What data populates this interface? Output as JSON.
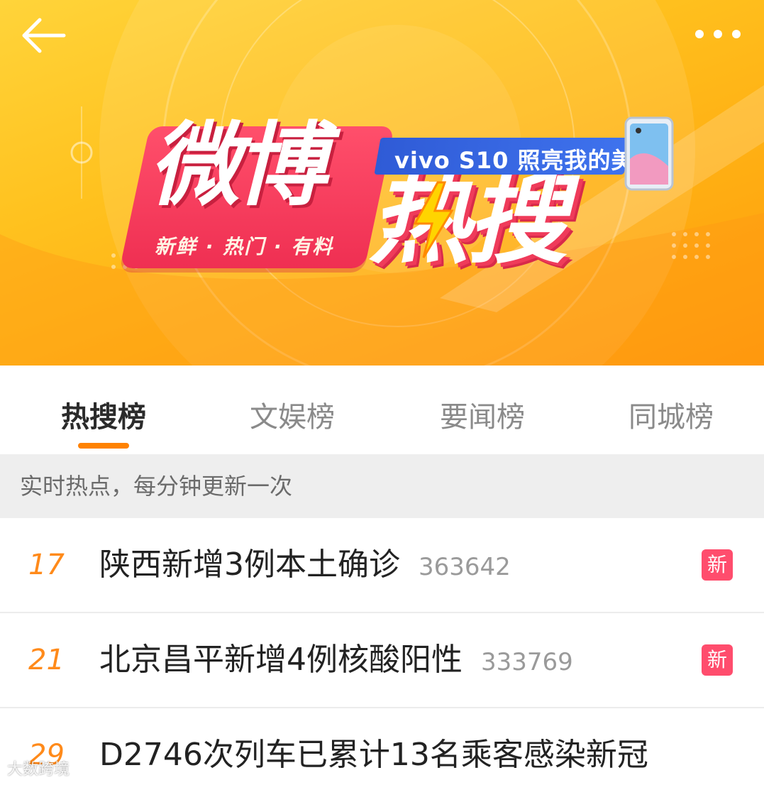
{
  "banner": {
    "logo_title": "微博",
    "logo_title_2": "热搜",
    "logo_subtitle": "新鲜 · 热门 · 有料",
    "sponsor_tag": "vivo S10 照亮我的美",
    "back_icon": "back-arrow-icon",
    "more_icon": "more-dots-icon"
  },
  "tabs": [
    {
      "label": "热搜榜",
      "active": true
    },
    {
      "label": "文娱榜",
      "active": false
    },
    {
      "label": "要闻榜",
      "active": false
    },
    {
      "label": "同城榜",
      "active": false
    }
  ],
  "notice": "实时热点，每分钟更新一次",
  "list": [
    {
      "rank": "17",
      "title": "陕西新增3例本土确诊",
      "count": "363642",
      "badge": "新"
    },
    {
      "rank": "21",
      "title": "北京昌平新增4例核酸阳性",
      "count": "333769",
      "badge": "新"
    },
    {
      "rank": "29",
      "title": "D2746次列车已累计13名乘客感染新冠",
      "count": "",
      "badge": ""
    }
  ],
  "watermark": "大数跨境",
  "colors": {
    "accent": "#ff8200",
    "rank": "#ff8a1a",
    "badge": "#ff4d6d",
    "banner": "#ffc21f"
  }
}
